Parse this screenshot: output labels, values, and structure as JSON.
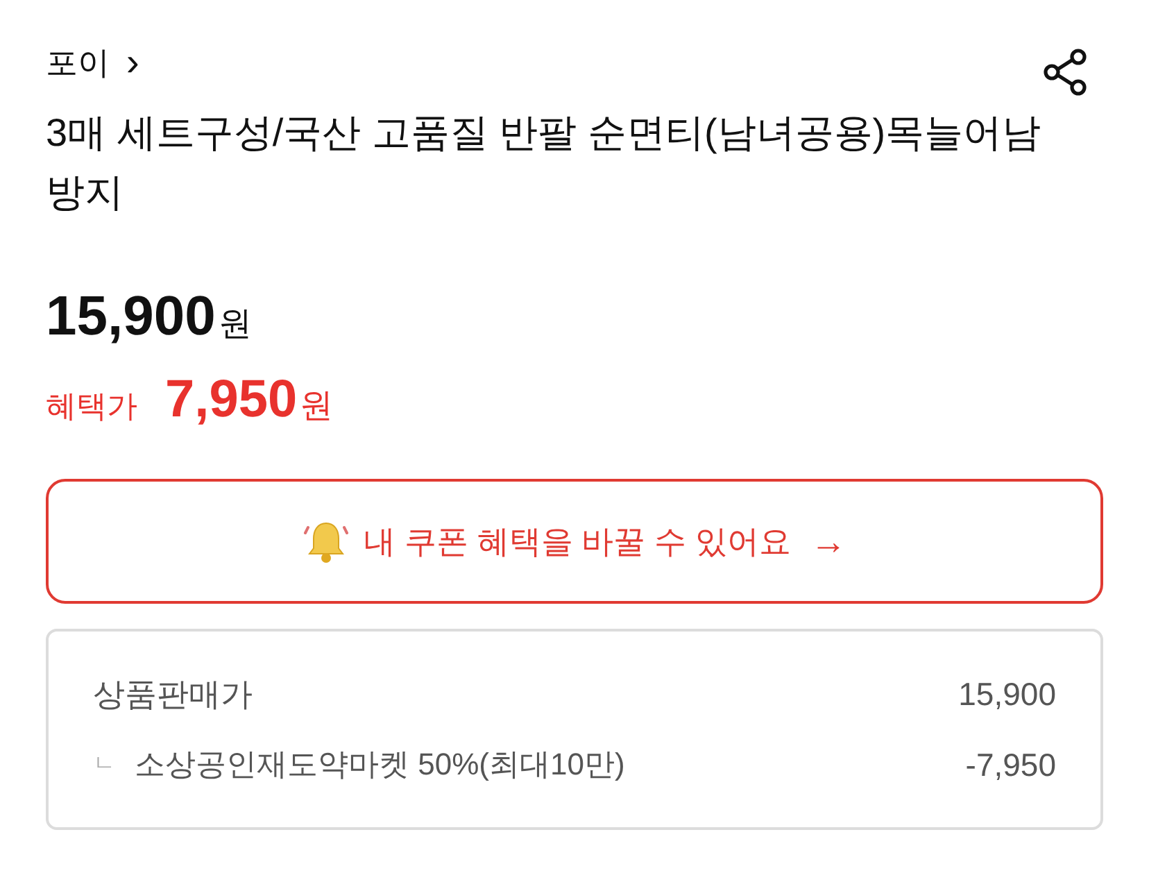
{
  "store": {
    "name": "포이",
    "chevron": "›"
  },
  "title": "3매 세트구성/국산 고품질 반팔 순면티(남녀공용)목늘어남 방지",
  "price": {
    "amount": "15,900",
    "unit": "원"
  },
  "benefit_price": {
    "label": "혜택가",
    "amount": "7,950",
    "unit": "원"
  },
  "coupon_banner": {
    "text": "내 쿠폰 혜택을 바꿀 수 있어요",
    "arrow": "→"
  },
  "breakdown": [
    {
      "kind": "main",
      "label": "상품판매가",
      "value": "15,900"
    },
    {
      "kind": "sub",
      "marker": "ㄴ",
      "label": "소상공인재도약마켓 50%(최대10만)",
      "value": "-7,950"
    }
  ]
}
